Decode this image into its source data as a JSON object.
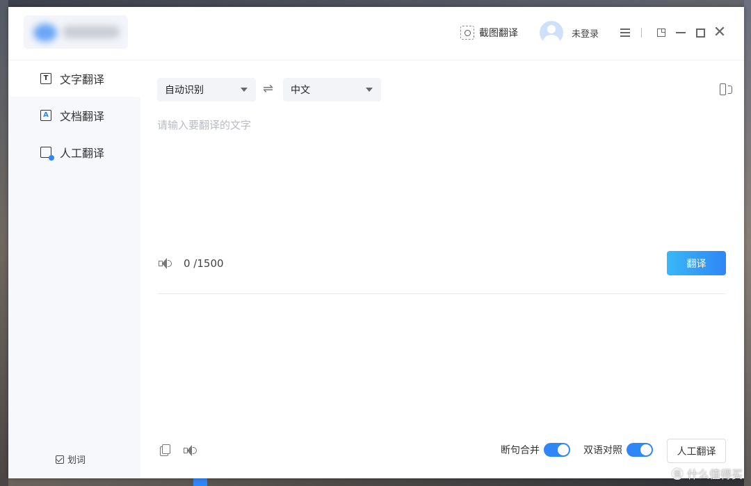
{
  "titlebar": {
    "screenshot_translate_label": "截图翻译",
    "user_status": "未登录"
  },
  "sidebar": {
    "items": [
      {
        "label": "文字翻译",
        "icon": "text-translate-icon",
        "active": true
      },
      {
        "label": "文档翻译",
        "icon": "document-translate-icon",
        "active": false
      },
      {
        "label": "人工翻译",
        "icon": "human-translate-icon",
        "active": false
      }
    ],
    "word_pick_label": "划词"
  },
  "translator": {
    "source_lang": "自动识别",
    "target_lang": "中文",
    "swap_glyph": "⇌",
    "input_placeholder": "请输入要翻译的文字",
    "input_value": "",
    "char_count": "0 /1500",
    "translate_button": "翻译"
  },
  "output_bar": {
    "sentence_merge_label": "断句合并",
    "sentence_merge_on": true,
    "bilingual_label": "双语对照",
    "bilingual_on": true,
    "human_translate_button": "人工翻译"
  },
  "watermark": {
    "glyph": "值",
    "text": "什么值得买"
  },
  "colors": {
    "accent": "#2f86f6",
    "button_gradient_start": "#38b8f6",
    "sidebar_bg": "#f7f8fc",
    "select_bg": "#f2f4f8"
  }
}
